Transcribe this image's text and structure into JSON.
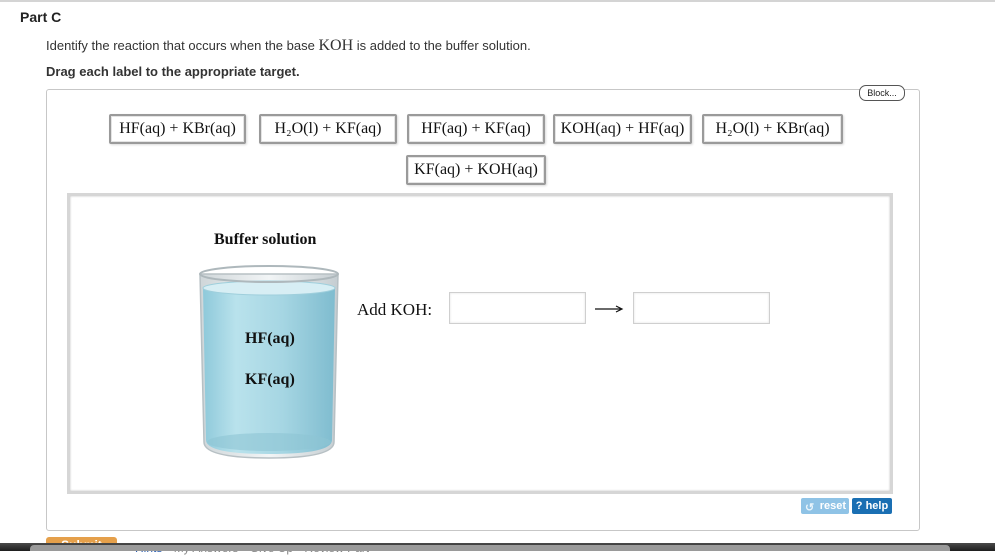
{
  "header": {
    "part_title": "Part C",
    "instruction_before": "Identify the reaction that occurs when the base ",
    "instruction_base": "KOH",
    "instruction_after": " is added to the buffer solution.",
    "drag_note": "Drag each label to the appropriate target."
  },
  "block_button": "Block...",
  "labels": [
    "HF(aq) + KBr(aq)",
    "H₂O(l) + KF(aq)",
    "HF(aq) + KF(aq)",
    "KOH(aq) + HF(aq)",
    "H₂O(l) + KBr(aq)",
    "KF(aq) + KOH(aq)"
  ],
  "target": {
    "title": "Buffer solution",
    "species": [
      "HF(aq)",
      "KF(aq)"
    ],
    "add_label": "Add KOH:"
  },
  "controls": {
    "reset": "reset",
    "help": "? help"
  },
  "footer": {
    "submit": "Submit",
    "links": [
      "Hints",
      "My Answers",
      "Give Up",
      "Review Part"
    ]
  },
  "colors": {
    "liquid": "#a9d9e6",
    "help_button": "#1a6fb3",
    "reset_button": "#8fc3e6",
    "submit_button": "#e5a04b"
  }
}
